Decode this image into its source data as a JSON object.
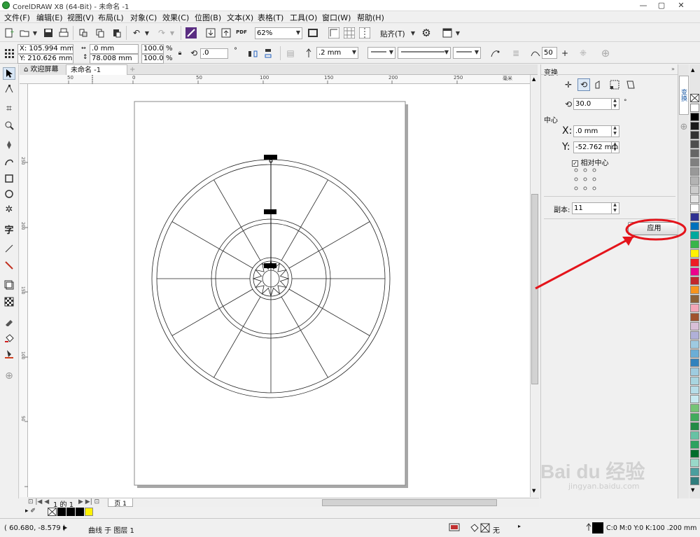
{
  "window": {
    "title": "CorelDRAW X8 (64-Bit) - 未命名 -1",
    "minimize": "—",
    "maximize": "▢",
    "close": "✕"
  },
  "menu": [
    "文件(F)",
    "编辑(E)",
    "视图(V)",
    "布局(L)",
    "对象(C)",
    "效果(C)",
    "位图(B)",
    "文本(X)",
    "表格(T)",
    "工具(O)",
    "窗口(W)",
    "帮助(H)"
  ],
  "toolbar": {
    "zoom": "62%",
    "snap": "贴齐(T)",
    "pdf": "PDF"
  },
  "property_bar": {
    "x": "X: 105.994 mm",
    "y": "Y: 210.626 mm",
    "width": ".0 mm",
    "height": "78.008 mm",
    "scale_w": "100.0",
    "scale_h": "100.0",
    "pct1": "%",
    "pct2": "%",
    "angle": ".0",
    "outline": ".2 mm",
    "degree": "°",
    "smooth": "50"
  },
  "doc_tabs": {
    "welcome": "欢迎屏幕",
    "doc": "未命名 -1",
    "add": "+"
  },
  "ruler": {
    "h_ticks": [
      "50",
      "0",
      "50",
      "100",
      "150",
      "200",
      "250"
    ],
    "v_ticks": [
      "250",
      "200",
      "150",
      "100",
      "50"
    ],
    "unit": "毫米"
  },
  "page_nav": {
    "page_info": "1 的 1",
    "page_tab": "页 1"
  },
  "docker": {
    "title": "变换",
    "angle": "30.0",
    "center_label": "中心",
    "x_label": "X:",
    "x_value": ".0 mm",
    "y_label": "Y:",
    "y_value": "-52.762 mm",
    "relative_center": "相对中心",
    "copies_label": "副本:",
    "copies_value": "11",
    "apply": "应用"
  },
  "vtab": {
    "label": "变换"
  },
  "status": {
    "coords": "( 60.680, -8.579 )",
    "object": "曲线 于 图层 1",
    "fill": "无",
    "color_info": "C:0 M:0 Y:0 K:100  .200 mm"
  },
  "watermark": {
    "brand": "Bai du 经验",
    "url": "jingyan.baidu.com"
  },
  "colors": {
    "palette": [
      "#ffffff",
      "#000000",
      "#1a1a1a",
      "#333333",
      "#4d4d4d",
      "#666666",
      "#808080",
      "#999999",
      "#b3b3b3",
      "#cccccc",
      "#e6e6e6",
      "#ffffff",
      "#2e3192",
      "#0071bc",
      "#00a99d",
      "#39b54a",
      "#fff200",
      "#ed1c24",
      "#ec008c",
      "#c1272d",
      "#f7941d",
      "#8c6239",
      "#f4a6b8",
      "#a0522d",
      "#d8bfd8",
      "#b0b0d8",
      "#9ecae1",
      "#6baed6",
      "#3182bd",
      "#9ecce0",
      "#a8d5e0",
      "#b6dde8",
      "#c7e9f1",
      "#74c476",
      "#41ab5d",
      "#238b45",
      "#66c2a4",
      "#2ca25f",
      "#006d2c",
      "#99d8c9",
      "#4a9e9e",
      "#2f7d7d",
      "#5e9e9e",
      "#437d7d"
    ],
    "accent_red": "#e4141b",
    "swatch_yellow": "#fff200"
  }
}
